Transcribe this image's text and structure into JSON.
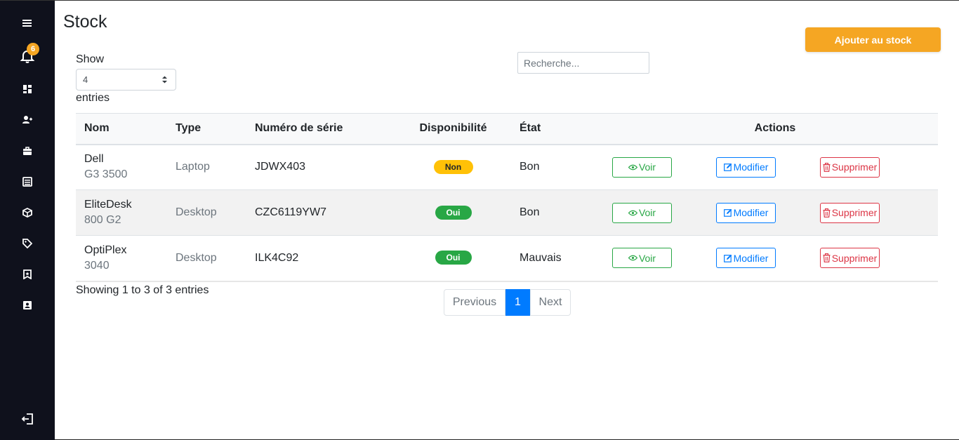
{
  "sidebar": {
    "notification_count": "6",
    "icons": [
      "menu-icon",
      "bell-icon",
      "dashboard-icon",
      "add-user-icon",
      "briefcase-icon",
      "list-icon",
      "cube-icon",
      "tag-icon",
      "bookmark-icon",
      "contact-icon",
      "logout-icon"
    ]
  },
  "header": {
    "title": "Stock",
    "add_button": "Ajouter au stock"
  },
  "controls": {
    "show_label": "Show",
    "entries_value": "4",
    "entries_label": "entries",
    "search_placeholder": "Recherche..."
  },
  "table": {
    "columns": [
      "Nom",
      "Type",
      "Numéro de série",
      "Disponibilité",
      "État",
      "Actions"
    ],
    "rows": [
      {
        "name": "Dell",
        "model": "G3 3500",
        "type": "Laptop",
        "serial": "JDWX403",
        "available": "Non",
        "state": "Bon"
      },
      {
        "name": "EliteDesk",
        "model": "800 G2",
        "type": "Desktop",
        "serial": "CZC6119YW7",
        "available": "Oui",
        "state": "Bon"
      },
      {
        "name": "OptiPlex",
        "model": "3040",
        "type": "Desktop",
        "serial": "ILK4C92",
        "available": "Oui",
        "state": "Mauvais"
      }
    ],
    "actions": {
      "view": "Voir",
      "edit": "Modifier",
      "delete": "Supprimer"
    }
  },
  "footer": {
    "info": "Showing 1 to 3 of 3 entries",
    "previous": "Previous",
    "current_page": "1",
    "next": "Next"
  },
  "colors": {
    "sidebar_bg": "#0f111c",
    "accent": "#f5a623",
    "badge_no": "#ffc107",
    "badge_yes": "#28a745",
    "primary": "#007bff",
    "danger": "#dc3545"
  }
}
